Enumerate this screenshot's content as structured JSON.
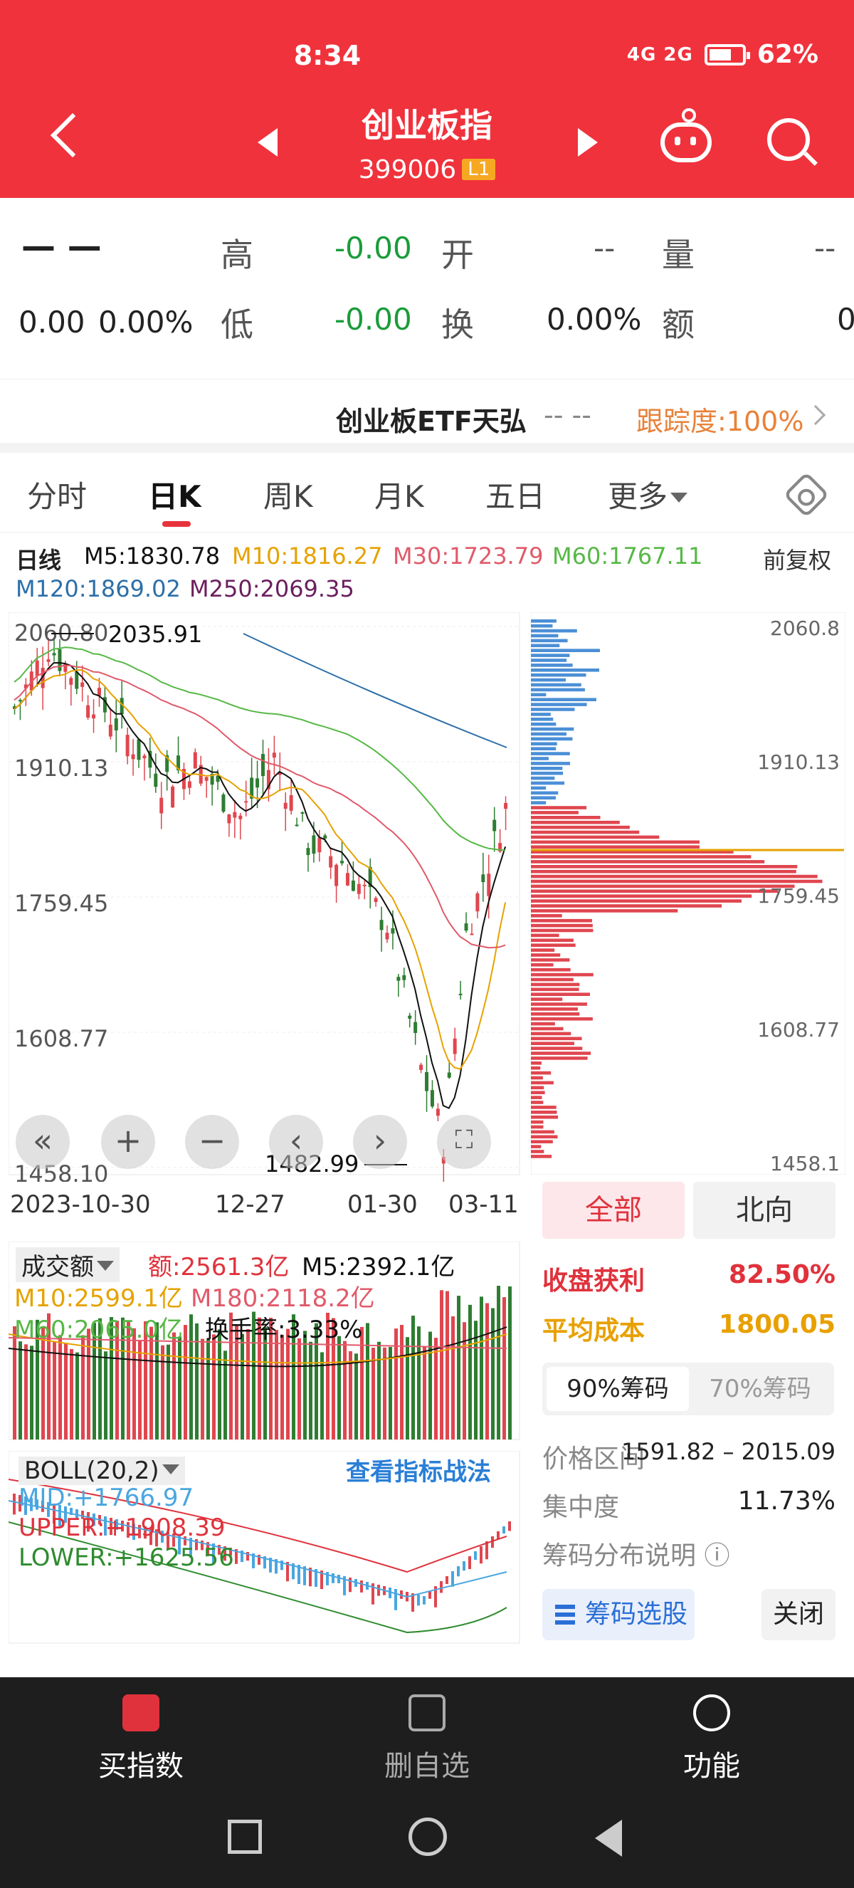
{
  "status": {
    "time": "8:34",
    "signal": "4G 2G",
    "battery": "62%"
  },
  "header": {
    "title": "创业板指",
    "code": "399006",
    "badge": "L1"
  },
  "quote": {
    "price": "— —",
    "change": "0.00",
    "change_pct": "0.00%",
    "high_label": "高",
    "high": "-0.00",
    "open_label": "开",
    "open": "-- ",
    "vol_label": "量",
    "vol": "--",
    "low_label": "低",
    "low": "-0.00",
    "turnover_label": "换",
    "turnover": "0.00%",
    "amt_label": "额",
    "amt": "0"
  },
  "etf": {
    "name": "创业板ETF天弘",
    "dash": "-- --",
    "track": "跟踪度:100%"
  },
  "tabs": [
    "分时",
    "日K",
    "周K",
    "月K",
    "五日",
    "更多"
  ],
  "ma": {
    "daily": "日线",
    "m5": "M5:1830.78",
    "m10": "M10:1816.27",
    "m30": "M30:1723.79",
    "m60": "M60:1767.11",
    "m120": "M120:1869.02",
    "m250": "M250:2069.35",
    "fq": "前复权"
  },
  "kline": {
    "y_labels": [
      "2060.80",
      "1910.13",
      "1759.45",
      "1608.77",
      "1458.10"
    ],
    "max_label": "2035.91",
    "min_label": "1482.99",
    "dates": [
      "2023-10-30",
      "12-27",
      "01-30",
      "03-11"
    ]
  },
  "chips": {
    "y_labels": [
      "2060.8",
      "1910.13",
      "1759.45",
      "1608.77",
      "1458.1"
    ],
    "seg_all": "全部",
    "seg_north": "北向",
    "profit_label": "收盘获利",
    "profit": "82.50%",
    "cost_label": "平均成本",
    "cost": "1800.05",
    "tab90": "90%筹码",
    "tab70": "70%筹码",
    "range_label": "价格区间",
    "range": "1591.82 – 2015.09",
    "conc_label": "集中度",
    "conc": "11.73%",
    "desc_label": "筹码分布说明 ⓘ",
    "pick_btn": "筹码选股",
    "close_btn": "关闭"
  },
  "volume": {
    "title": "成交额",
    "amt": "额:2561.3亿",
    "m5": "M5:2392.1亿",
    "m10": "M10:2599.1亿",
    "m180": "M180:2118.2亿",
    "m60": "M60:2065.0亿",
    "turn": "换手率:3.33%"
  },
  "boll": {
    "title": "BOLL(20,2)",
    "link": "查看指标战法",
    "mid": "MID:+1766.97",
    "upper": "UPPER:+1908.39",
    "lower": "LOWER:+1625.56"
  },
  "nav": {
    "buy": "买指数",
    "del": "删自选",
    "func": "功能"
  },
  "colors": {
    "brand": "#f0323c",
    "up": "#e0464f",
    "down": "#2e7d32",
    "chip_profit": "#e0464f",
    "chip_loss": "#4b8fd6"
  }
}
